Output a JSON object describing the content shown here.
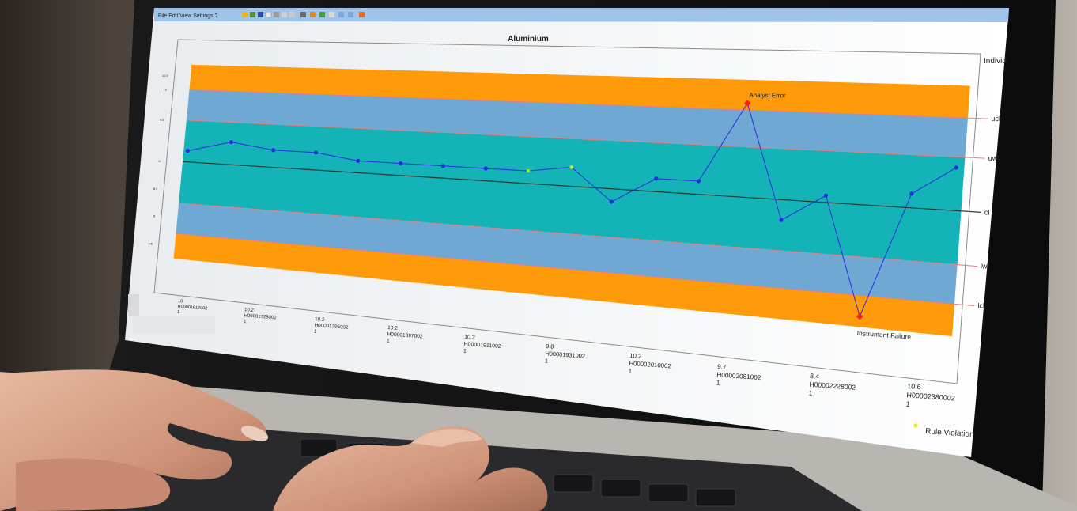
{
  "app": {
    "toolbar_menu": "File  Edit  View  Settings  ?"
  },
  "chart_data": {
    "type": "line",
    "title": "Aluminium",
    "panel_label": "Individ",
    "limit_lines": [
      "ucl",
      "uwl",
      "cl",
      "lwl",
      "lcl"
    ],
    "y_ticks": [
      "10.5",
      "10",
      "9.5",
      "9",
      "8.5",
      "8",
      "7.5"
    ],
    "values": [
      10.2,
      10.4,
      10.3,
      10.3,
      10.2,
      10.2,
      10.2,
      10.2,
      10.2,
      10.3,
      9.8,
      10.2,
      10.2,
      11.4,
      9.7,
      10.1,
      8.4,
      10.2,
      10.6
    ],
    "special_points": [
      {
        "index": 8,
        "marker": "Rule Violation",
        "color": "#b4e61e"
      },
      {
        "index": 9,
        "marker": "Rule Violation",
        "color": "#e8e81e"
      },
      {
        "index": 13,
        "marker": "Analyst Error",
        "color": "#ff1a1a"
      },
      {
        "index": 16,
        "marker": "Instrument Failure",
        "color": "#ff1a1a"
      }
    ],
    "x_labels": [
      {
        "value": "10",
        "id": "H00001617002",
        "n": "1"
      },
      {
        "value": "10.2",
        "id": "H00001728002",
        "n": "1"
      },
      {
        "value": "10.2",
        "id": "H00001795002",
        "n": "1"
      },
      {
        "value": "10.2",
        "id": "H00001897002",
        "n": "1"
      },
      {
        "value": "10.2",
        "id": "H00001911002",
        "n": "1"
      },
      {
        "value": "9.8",
        "id": "H00001931002",
        "n": "1"
      },
      {
        "value": "10.2",
        "id": "H00002010002",
        "n": "1"
      },
      {
        "value": "9.7",
        "id": "H00002081002",
        "n": "1"
      },
      {
        "value": "8.4",
        "id": "H00002228002",
        "n": "1"
      },
      {
        "value": "10.6",
        "id": "H00002380002",
        "n": "1"
      }
    ],
    "annotations": [
      "Analyst Error",
      "Instrument Failure"
    ],
    "legend": "Rule Violation",
    "colors": {
      "outer_band": "#ff9a0a",
      "warning_band": "#6fa8d2",
      "inner_band": "#13b3b8",
      "series": "#2a2ae0",
      "limit_line": "#e88080",
      "centre_line": "#2d3a2d"
    }
  }
}
